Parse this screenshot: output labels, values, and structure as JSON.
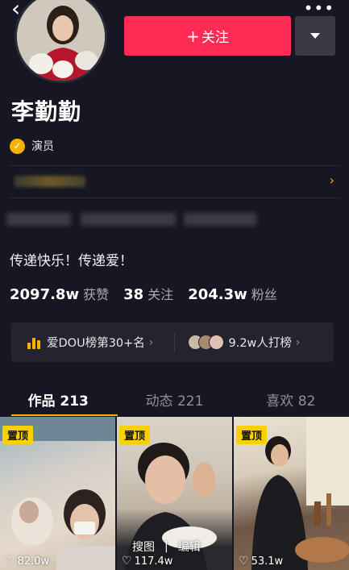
{
  "header": {
    "back_icon": "chevron-left-icon",
    "more_icon": "more-icon",
    "follow_label": "关注",
    "follow_color": "#fe2c55"
  },
  "profile": {
    "name": "李勤勤",
    "verify_label": "演员",
    "verify_color": "#f5b300",
    "bio": "传递快乐！传递爱！"
  },
  "stats": [
    {
      "num": "2097.8w",
      "label": "获赞"
    },
    {
      "num": "38",
      "label": "关注"
    },
    {
      "num": "204.3w",
      "label": "粉丝"
    }
  ],
  "rank": {
    "left_label": "爱DOU榜第30+名",
    "right_label": "9.2w人打榜"
  },
  "tabs": [
    {
      "label": "作品 213"
    },
    {
      "label": "动态 221"
    },
    {
      "label": "喜欢 82"
    }
  ],
  "videos": [
    {
      "pin": "置顶",
      "likes": "82.0w"
    },
    {
      "pin": "置顶",
      "likes": "117.4w"
    },
    {
      "pin": "置顶",
      "likes": "53.1w"
    }
  ],
  "overlay": {
    "search_label": "搜图",
    "edit_label": "编辑"
  }
}
